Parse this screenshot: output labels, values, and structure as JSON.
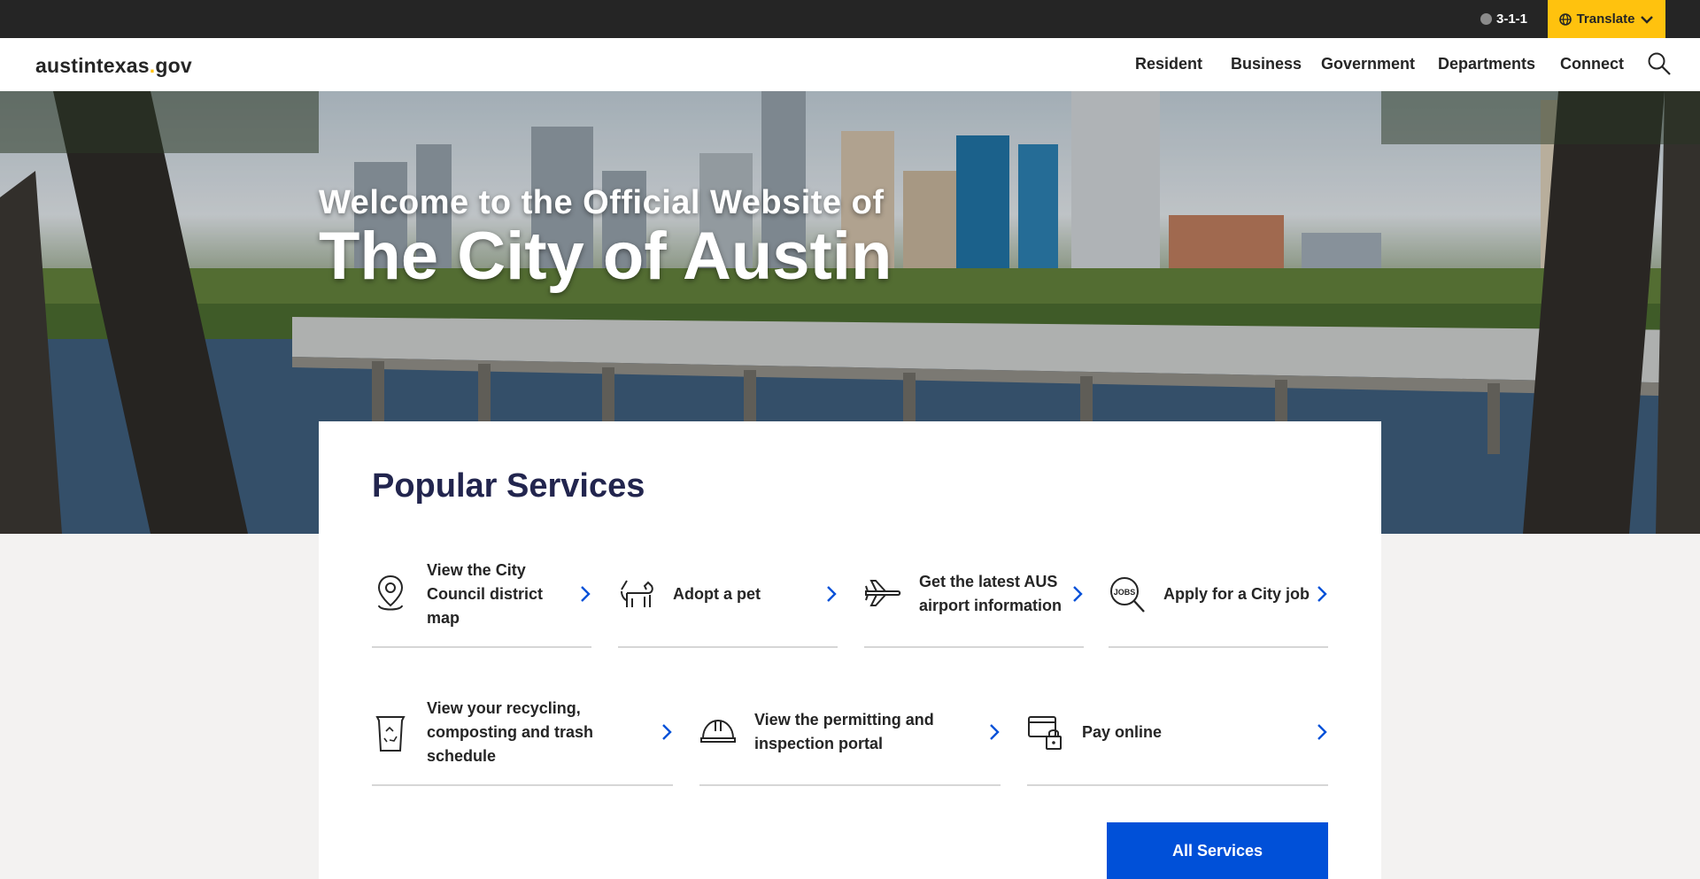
{
  "topbar": {
    "phone_label": "3-1-1",
    "translate_label": "Translate"
  },
  "header": {
    "logo_main": "austintexas",
    "logo_dot": ".",
    "logo_tld": "gov",
    "nav": [
      "Resident",
      "Business",
      "Government",
      "Departments",
      "Connect"
    ]
  },
  "hero": {
    "subtitle": "Welcome to the Official Website of",
    "title": "The City of Austin"
  },
  "popular": {
    "heading": "Popular Services",
    "services": [
      {
        "label": "View the City Council district map",
        "icon": "map-pin-icon"
      },
      {
        "label": "Adopt a pet",
        "icon": "dog-icon"
      },
      {
        "label": "Get the latest AUS airport information",
        "icon": "airplane-icon"
      },
      {
        "label": "Apply for a City job",
        "icon": "jobs-search-icon"
      },
      {
        "label": "View your recycling, composting and trash schedule",
        "icon": "recycling-bin-icon"
      },
      {
        "label": "View the permitting and inspection portal",
        "icon": "hard-hat-icon"
      },
      {
        "label": "Pay online",
        "icon": "secure-payment-icon"
      }
    ],
    "all_services_label": "All Services"
  },
  "colors": {
    "topbar": "#252525",
    "translate": "#ffc20e",
    "primary_button": "#0050d8",
    "chevron": "#0050d8"
  }
}
